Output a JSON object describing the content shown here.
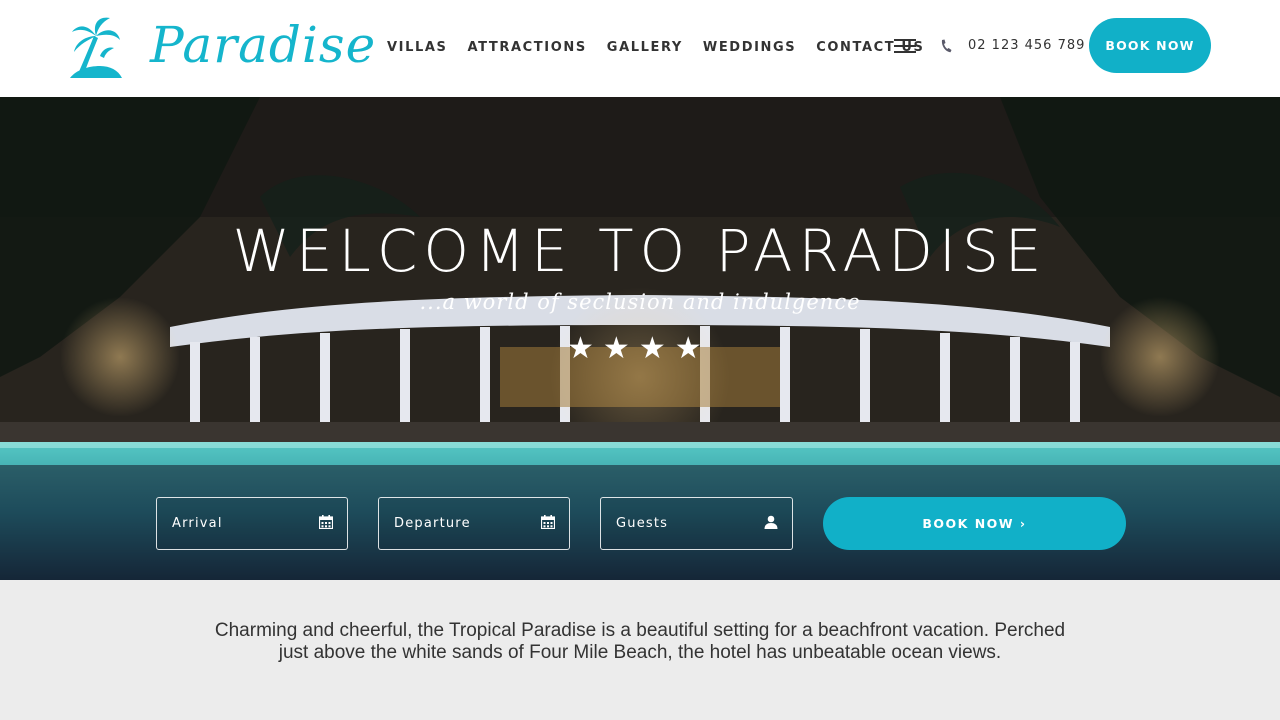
{
  "brand": {
    "name": "Paradise",
    "accent": "#11b0c8"
  },
  "nav": {
    "items": [
      {
        "label": "VILLAS"
      },
      {
        "label": "ATTRACTIONS"
      },
      {
        "label": "GALLERY"
      },
      {
        "label": "WEDDINGS"
      },
      {
        "label": "CONTACT US"
      }
    ],
    "menu_icon": "hamburger-icon",
    "phone": "02 123 456 789",
    "phone_icon": "phone-icon",
    "book_label": "BOOK NOW"
  },
  "hero": {
    "title": "WELCOME TO PARADISE",
    "subtitle": "...a world of seclusion and indulgence",
    "rating": 4,
    "star_icon": "star-icon"
  },
  "booking": {
    "arrival": {
      "label": "Arrival",
      "icon": "calendar-icon"
    },
    "departure": {
      "label": "Departure",
      "icon": "calendar-icon"
    },
    "guests": {
      "label": "Guests",
      "icon": "user-icon"
    },
    "submit_label": "BOOK NOW  ›"
  },
  "intro": {
    "text": "Charming and cheerful, the Tropical Paradise is a beautiful setting for a beachfront vacation. Perched just above the white sands of Four Mile Beach, the hotel has unbeatable ocean views."
  }
}
